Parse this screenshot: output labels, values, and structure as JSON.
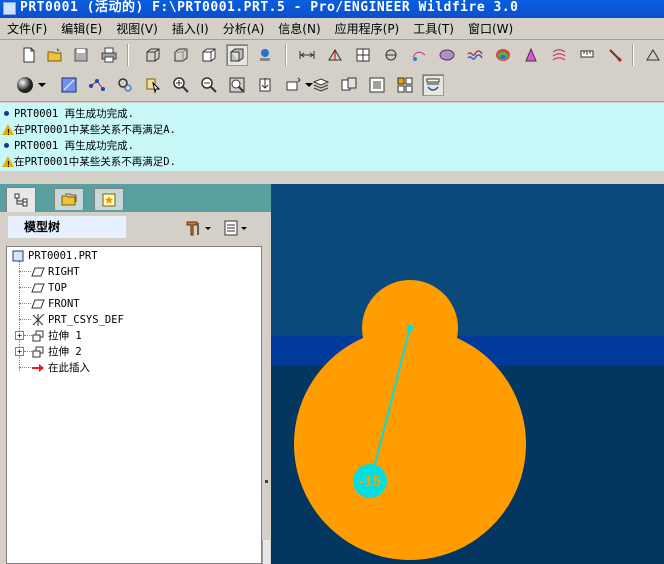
{
  "window": {
    "title": "PRT0001 (活动的) F:\\PRT0001.PRT.5 - Pro/ENGINEER Wildfire 3.0"
  },
  "menu": {
    "items": [
      "文件(F)",
      "编辑(E)",
      "视图(V)",
      "插入(I)",
      "分析(A)",
      "信息(N)",
      "应用程序(P)",
      "工具(T)",
      "窗口(W)"
    ]
  },
  "messages": [
    {
      "type": "info",
      "text": "PRT0001 再生成功完成."
    },
    {
      "type": "warning",
      "text": "在PRT0001中某些关系不再满足A."
    },
    {
      "type": "info",
      "text": "PRT0001 再生成功完成."
    },
    {
      "type": "warning",
      "text": "在PRT0001中某些关系不再满足D."
    }
  ],
  "colors": {
    "message_bg": "#c8f8f8",
    "model_fill": "#ff9c00",
    "dimension_color": "#00e0e0",
    "graphics_bg": "#063a6a"
  },
  "panel": {
    "tree_title": "模型树"
  },
  "tree": {
    "root": "PRT0001.PRT",
    "items": [
      {
        "label": "RIGHT",
        "icon": "datum-plane-icon"
      },
      {
        "label": "TOP",
        "icon": "datum-plane-icon"
      },
      {
        "label": "FRONT",
        "icon": "datum-plane-icon"
      },
      {
        "label": "PRT_CSYS_DEF",
        "icon": "csys-icon"
      },
      {
        "label": "拉伸 1",
        "icon": "extrude-icon",
        "expandable": true
      },
      {
        "label": "拉伸 2",
        "icon": "extrude-icon",
        "expandable": true
      },
      {
        "label": "在此插入",
        "icon": "insert-here-arrow-icon"
      }
    ]
  },
  "graphics": {
    "dimension_value": "-15"
  }
}
